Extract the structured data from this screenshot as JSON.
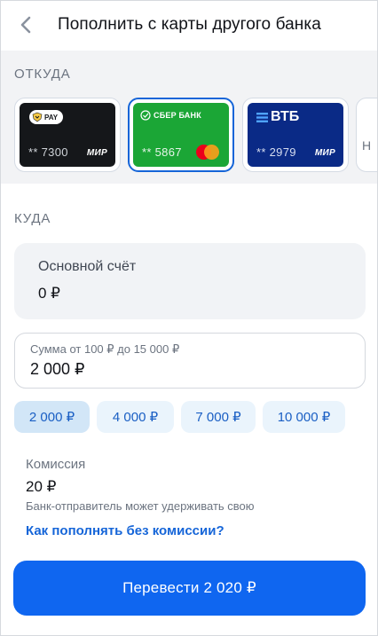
{
  "header": {
    "title": "Пополнить с карты другого банка"
  },
  "from": {
    "label": "ОТКУДА",
    "cards": [
      {
        "brand": "PAY",
        "number": "** 7300",
        "network": "МИР",
        "color": "#15171a",
        "selected": false
      },
      {
        "brand": "СБЕР БАНК",
        "number": "** 5867",
        "network": "mastercard",
        "color": "#1ba636",
        "selected": true
      },
      {
        "brand": "ВТБ",
        "number": "** 2979",
        "network": "МИР",
        "color": "#0a2a86",
        "selected": false
      },
      {
        "brand": "",
        "number": "Н",
        "network": "",
        "color": "#ffffff",
        "selected": false
      }
    ]
  },
  "to": {
    "label": "КУДА",
    "account": {
      "name": "Основной счёт",
      "balance": "0 ₽"
    },
    "amount": {
      "hint": "Сумма от 100 ₽ до 15 000 ₽",
      "value": "2 000 ₽"
    },
    "quick_amounts": [
      "2 000 ₽",
      "4 000 ₽",
      "7 000 ₽",
      "10 000 ₽"
    ],
    "active_quick_amount": "2 000 ₽",
    "commission": {
      "title": "Комиссия",
      "value": "20 ₽",
      "note": "Банк-отправитель может удерживать свою",
      "link": "Как пополнять без комиссии?"
    },
    "submit_label": "Перевести 2 020 ₽"
  }
}
